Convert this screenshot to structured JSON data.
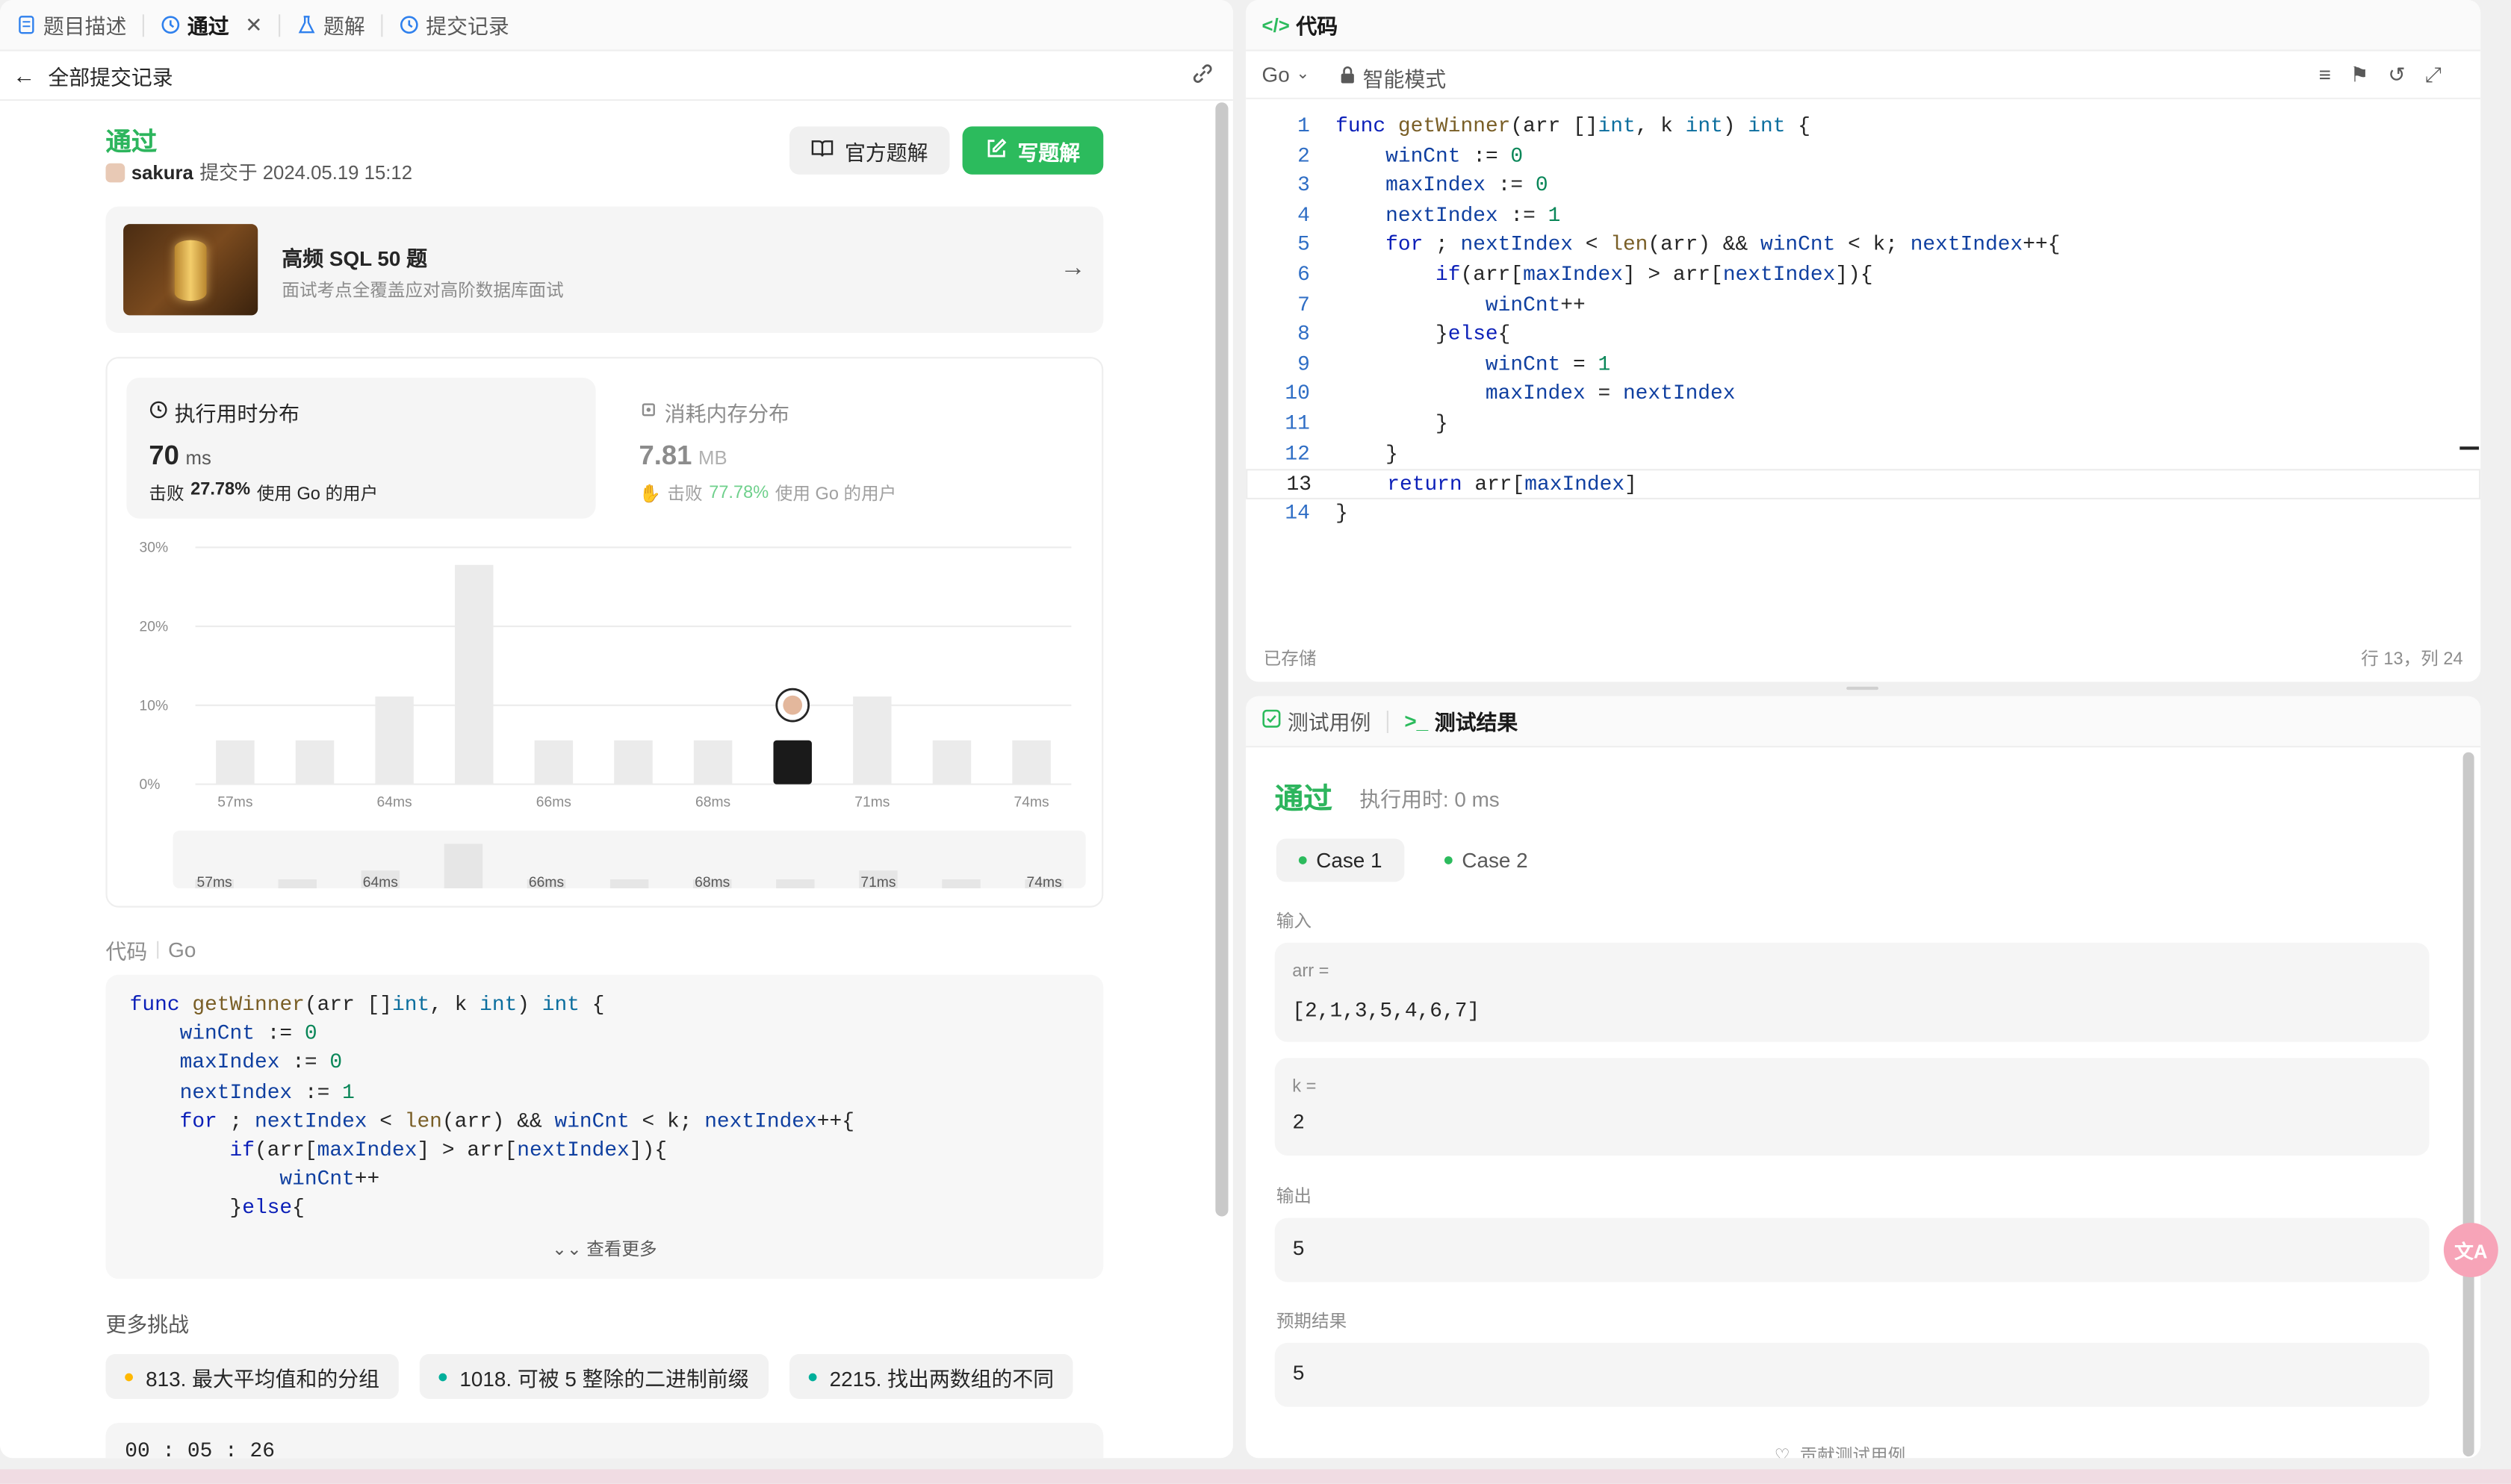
{
  "left_tabs": [
    {
      "label": "题目描述",
      "icon": "document-icon"
    },
    {
      "label": "通过",
      "icon": "history-icon",
      "active": true
    },
    {
      "label": "题解",
      "icon": "flask-icon"
    },
    {
      "label": "提交记录",
      "icon": "history-icon"
    }
  ],
  "back": {
    "label": "全部提交记录"
  },
  "submission": {
    "status": "通过",
    "user": "sakura",
    "submitted_text": "提交于 2024.05.19 15:12",
    "official_solution_btn": "官方题解",
    "write_solution_btn": "写题解"
  },
  "promo": {
    "title": "高频 SQL 50 题",
    "subtitle": "面试考点全覆盖应对高阶数据库面试"
  },
  "runtime": {
    "title": "执行用时分布",
    "value": "70",
    "unit": "ms",
    "beat_prefix": "击败",
    "beat_pct": "27.78%",
    "beat_suffix": "使用 Go 的用户"
  },
  "memory": {
    "title": "消耗内存分布",
    "value": "7.81",
    "unit": "MB",
    "beat_prefix": "击败",
    "beat_pct": "77.78%",
    "beat_suffix": "使用 Go 的用户"
  },
  "chart_data": {
    "type": "bar",
    "categories": [
      "57ms",
      "",
      "64ms",
      "",
      "66ms",
      "",
      "68ms",
      "",
      "71ms",
      "",
      "74ms"
    ],
    "values": [
      5.56,
      5.56,
      11.11,
      27.78,
      5.56,
      5.56,
      5.56,
      5.56,
      11.11,
      5.56,
      5.56
    ],
    "highlight_index": 7,
    "yticks": [
      "30%",
      "20%",
      "10%",
      "0%"
    ],
    "ylim": [
      0,
      30
    ],
    "grid": true,
    "colors": {
      "bar": "#ebebeb",
      "highlight": "#1a1a1a"
    }
  },
  "code_section": {
    "label": "代码",
    "lang": "Go",
    "more": "查看更多"
  },
  "more_challenges": {
    "title": "更多挑战",
    "items": [
      {
        "label": "813. 最大平均值和的分组",
        "color": "#ffb800"
      },
      {
        "label": "1018. 可被 5 整除的二进制前缀",
        "color": "#00af9b"
      },
      {
        "label": "2215. 找出两数组的不同",
        "color": "#00af9b"
      }
    ]
  },
  "timer": "00 : 05 : 26",
  "editor": {
    "title": "代码",
    "lang": "Go",
    "mode": "智能模式",
    "saved": "已存储",
    "cursor": "行 13，列 24",
    "lines": [
      "func getWinner(arr []int, k int) int {",
      "    winCnt := 0",
      "    maxIndex := 0",
      "    nextIndex := 1",
      "    for ; nextIndex < len(arr) && winCnt < k; nextIndex++{",
      "        if(arr[maxIndex] > arr[nextIndex]){",
      "            winCnt++",
      "        }else{",
      "            winCnt = 1",
      "            maxIndex = nextIndex",
      "        }",
      "    }",
      "    return arr[maxIndex]",
      "}"
    ],
    "preview_lines": [
      "func getWinner(arr []int, k int) int {",
      "    winCnt := 0",
      "    maxIndex := 0",
      "    nextIndex := 1",
      "    for ; nextIndex < len(arr) && winCnt < k; nextIndex++{",
      "        if(arr[maxIndex] > arr[nextIndex]){",
      "            winCnt++",
      "        }else{"
    ]
  },
  "test": {
    "tab_cases": "测试用例",
    "tab_results": "测试结果",
    "status": "通过",
    "runtime": "执行用时: 0 ms",
    "cases": [
      "Case 1",
      "Case 2"
    ],
    "input_label": "输入",
    "arr_label": "arr =",
    "arr_value": "[2,1,3,5,4,6,7]",
    "k_label": "k =",
    "k_value": "2",
    "output_label": "输出",
    "output_value": "5",
    "expected_label": "预期结果",
    "expected_value": "5",
    "contribute": "贡献测试用例"
  }
}
